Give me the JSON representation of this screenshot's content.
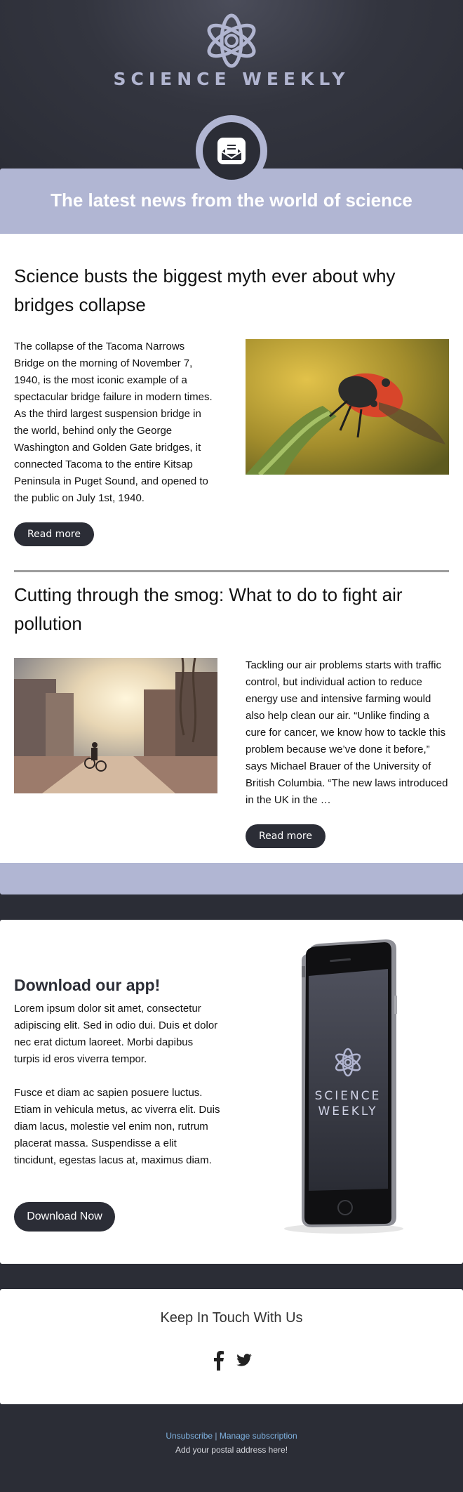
{
  "header": {
    "brand": "SCIENCE WEEKLY",
    "tagline": "The latest news from the world of science"
  },
  "articles": [
    {
      "title": "Science busts the biggest myth ever about why bridges collapse",
      "body": "The collapse of the Tacoma Narrows Bridge on the morning of November 7, 1940, is the most iconic example of a spectacular bridge failure in modern times. As the third largest suspension bridge in the world, behind only the George Washington and Golden Gate bridges, it connected Tacoma to the entire Kitsap Peninsula in Puget Sound, and opened to the public on July 1st, 1940.",
      "button": "Read more",
      "image": "ladybug-photo"
    },
    {
      "title": "Cutting through the smog: What to do to fight air pollution",
      "body": "Tackling our air problems starts with traffic control, but individual action to reduce energy use and intensive farming would also help clean our air. “Unlike finding a cure for cancer, we know how to tackle this problem because we’ve done it before,” says Michael Brauer of the University of British Columbia. “The new laws introduced in the UK in the …",
      "button": "Read more",
      "image": "city-cyclist-photo"
    }
  ],
  "app": {
    "title": "Download our app!",
    "paragraph1": "Lorem ipsum dolor sit amet, consectetur adipiscing elit. Sed in odio dui. Duis et dolor nec erat dictum laoreet. Morbi dapibus turpis id eros viverra tempor.",
    "paragraph2": "Fusce et diam ac sapien posuere luctus. Etiam in vehicula metus, ac viverra elit. Duis diam lacus, molestie vel enim non, rutrum placerat massa. Suspendisse a elit tincidunt, egestas lacus at, maximus diam.",
    "button": "Download Now",
    "phone_brand_line1": "SCIENCE",
    "phone_brand_line2": "WEEKLY"
  },
  "social": {
    "title": "Keep In Touch With Us",
    "icons": [
      "facebook-icon",
      "twitter-icon"
    ]
  },
  "footer": {
    "unsubscribe": "Unsubscribe",
    "separator": "|",
    "manage": "Manage subscription",
    "address": "Add your postal address here!"
  },
  "colors": {
    "dark": "#2b2d36",
    "lavender": "#b1b6d3",
    "link": "#7fb2e0"
  }
}
